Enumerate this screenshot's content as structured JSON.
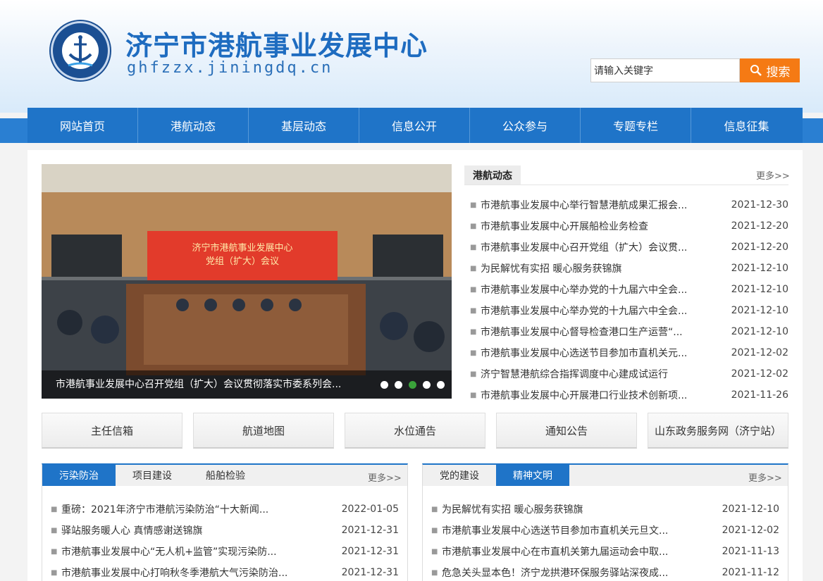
{
  "header": {
    "site_title": "济宁市港航事业发展中心",
    "site_domain": "ghfzzx.jiningdq.cn",
    "search_placeholder": "请输入关键字",
    "search_button": "搜索"
  },
  "nav": {
    "items": [
      "网站首页",
      "港航动态",
      "基层动态",
      "信息公开",
      "公众参与",
      "专题专栏",
      "信息征集"
    ]
  },
  "slider": {
    "caption": "市港航事业发展中心召开党组（扩大）会议贯彻落实市委系列会...",
    "banner_line1": "济宁市港航事业发展中心",
    "banner_line2": "党组（扩大）会议",
    "dots": 5,
    "active_dot": 3
  },
  "news": {
    "heading": "港航动态",
    "more": "更多>>",
    "items": [
      {
        "title": "市港航事业发展中心举行智慧港航成果汇报会...",
        "date": "2021-12-30"
      },
      {
        "title": "市港航事业发展中心开展船检业务检查",
        "date": "2021-12-20"
      },
      {
        "title": "市港航事业发展中心召开党组（扩大）会议贯...",
        "date": "2021-12-20"
      },
      {
        "title": "为民解忧有实招 暖心服务获锦旗",
        "date": "2021-12-10"
      },
      {
        "title": "市港航事业发展中心举办党的十九届六中全会...",
        "date": "2021-12-10"
      },
      {
        "title": "市港航事业发展中心举办党的十九届六中全会...",
        "date": "2021-12-10"
      },
      {
        "title": "市港航事业发展中心督导检查港口生产运营“...",
        "date": "2021-12-10"
      },
      {
        "title": "市港航事业发展中心选送节目参加市直机关元...",
        "date": "2021-12-02"
      },
      {
        "title": "济宁智慧港航综合指挥调度中心建成试运行",
        "date": "2021-12-02"
      },
      {
        "title": "市港航事业发展中心开展港口行业技术创新项...",
        "date": "2021-11-26"
      }
    ]
  },
  "quick_links": [
    "主任信箱",
    "航道地图",
    "水位通告",
    "通知公告",
    "山东政务服务网（济宁站）"
  ],
  "box_left": {
    "tabs": [
      "污染防治",
      "项目建设",
      "船舶检验"
    ],
    "active_tab": 0,
    "more": "更多>>",
    "items": [
      {
        "title": "重磅：2021年济宁市港航污染防治“十大新闻...",
        "date": "2022-01-05"
      },
      {
        "title": "驿站服务暖人心 真情感谢送锦旗",
        "date": "2021-12-31"
      },
      {
        "title": "市港航事业发展中心“无人机+监管”实现污染防...",
        "date": "2021-12-31"
      },
      {
        "title": "市港航事业发展中心打响秋冬季港航大气污染防治...",
        "date": "2021-12-31"
      }
    ]
  },
  "box_right": {
    "tabs": [
      "党的建设",
      "精神文明"
    ],
    "active_tab": 1,
    "more": "更多>>",
    "items": [
      {
        "title": "为民解忧有实招 暖心服务获锦旗",
        "date": "2021-12-10"
      },
      {
        "title": "市港航事业发展中心选送节目参加市直机关元旦文...",
        "date": "2021-12-02"
      },
      {
        "title": "市港航事业发展中心在市直机关第九届运动会中取...",
        "date": "2021-11-13"
      },
      {
        "title": "危急关头显本色！济宁龙拱港环保服务驿站深夜成...",
        "date": "2021-11-12"
      }
    ]
  },
  "colors": {
    "nav_blue": "#1f74c8",
    "title_blue": "#1e6cc0",
    "search_orange": "#f57a14",
    "active_dot_green": "#3aa33a"
  }
}
